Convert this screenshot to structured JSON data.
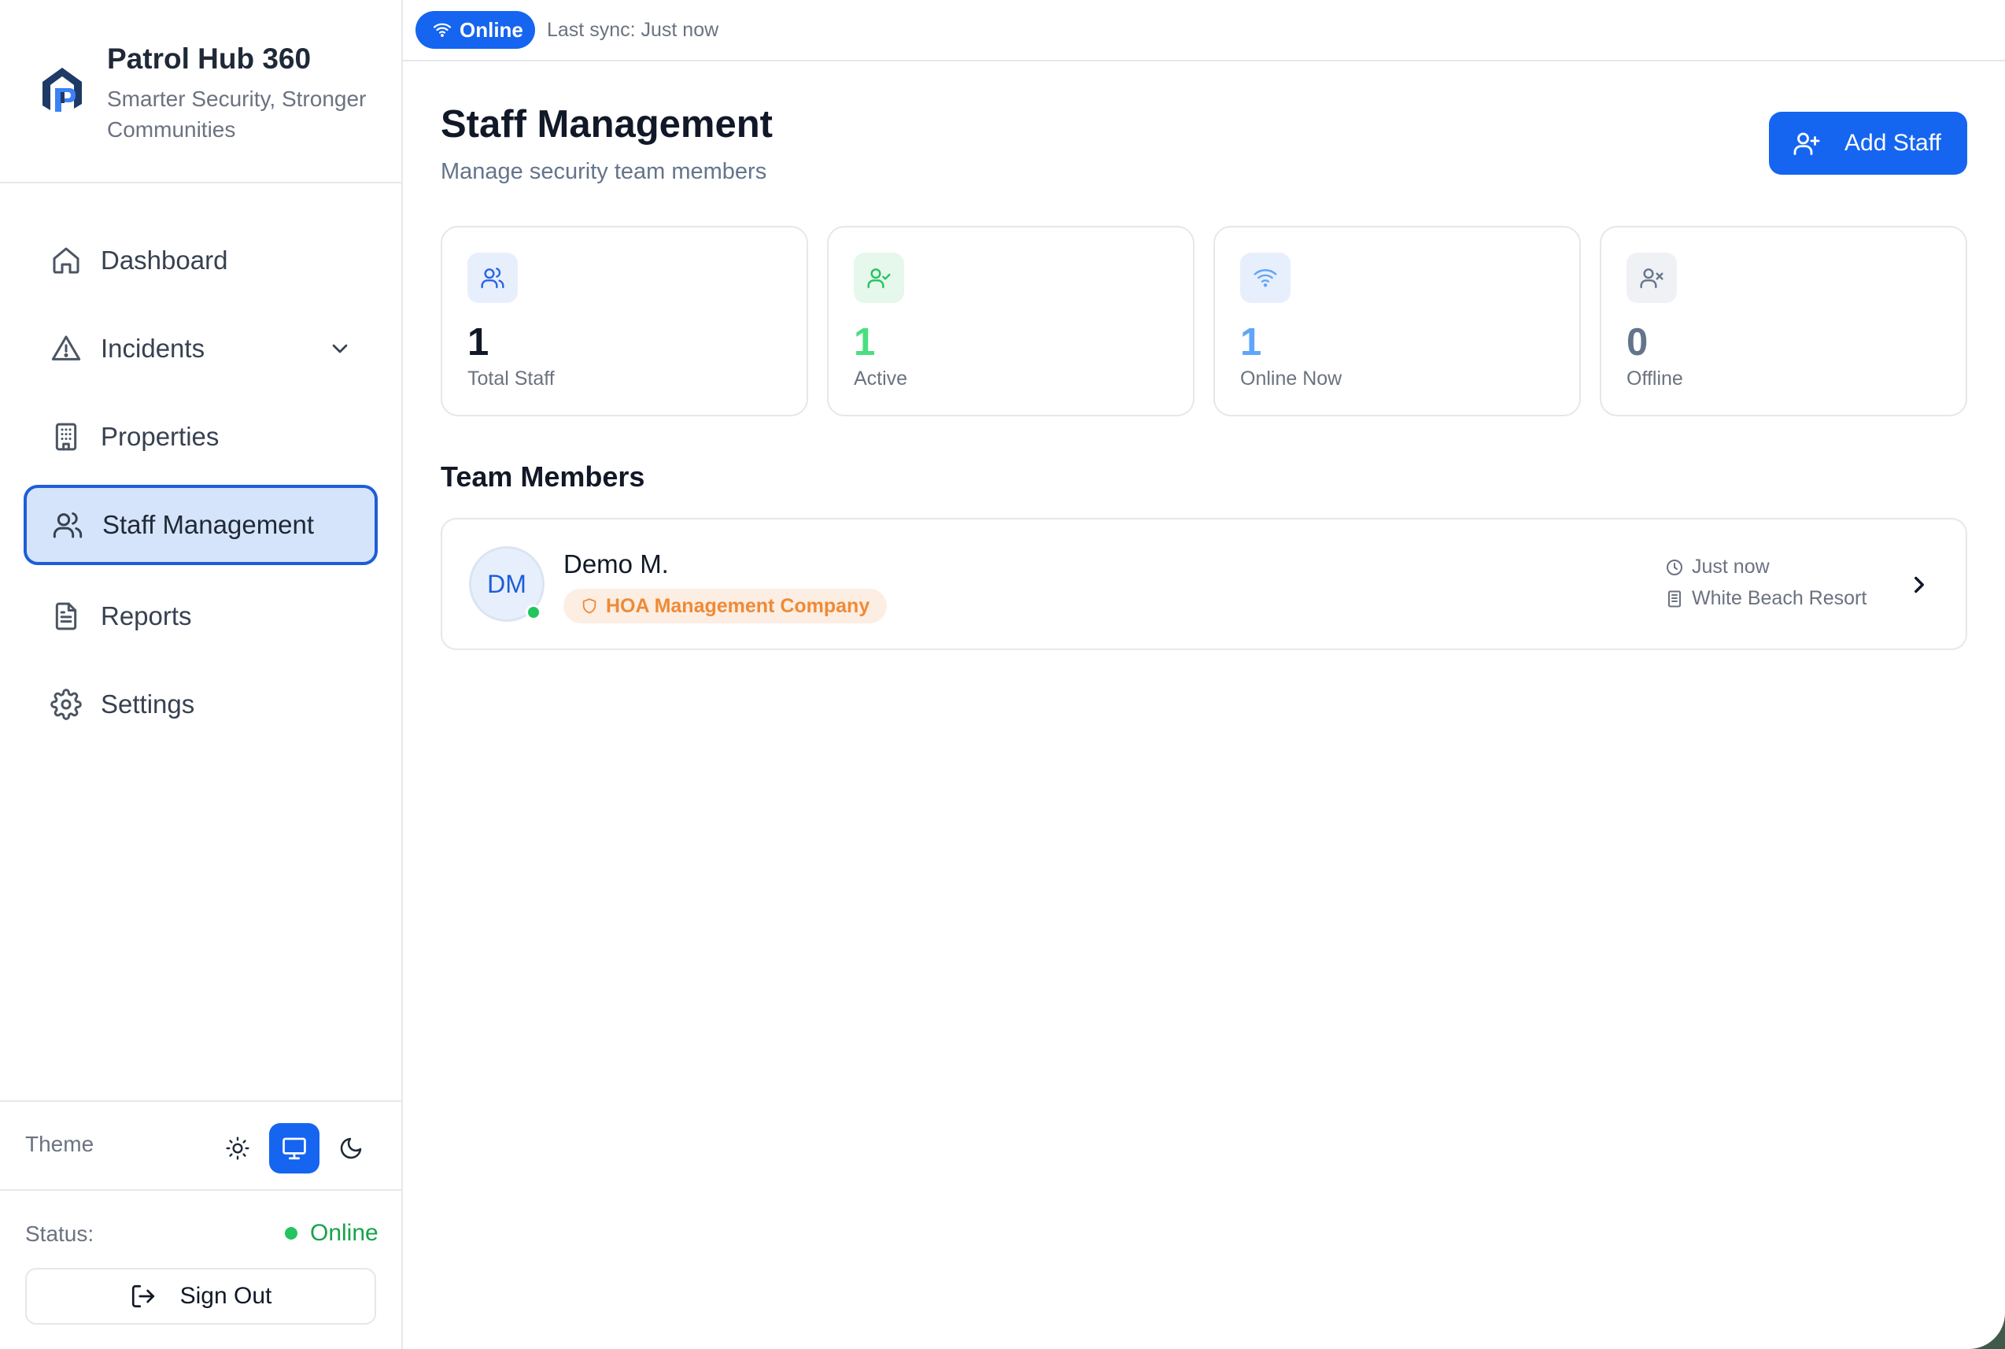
{
  "brand": {
    "title": "Patrol Hub 360",
    "subtitle": "Smarter Security, Stronger Communities",
    "logo_icon": "shield-p-logo"
  },
  "sidebar": {
    "items": [
      {
        "label": "Dashboard",
        "icon": "home-icon",
        "active": false
      },
      {
        "label": "Incidents",
        "icon": "alert-triangle-icon",
        "active": false,
        "expandable": true
      },
      {
        "label": "Properties",
        "icon": "building-icon",
        "active": false
      },
      {
        "label": "Staff Management",
        "icon": "users-icon",
        "active": true
      },
      {
        "label": "Reports",
        "icon": "file-text-icon",
        "active": false
      },
      {
        "label": "Settings",
        "icon": "gear-icon",
        "active": false
      }
    ],
    "theme": {
      "label": "Theme",
      "options": [
        "light",
        "system",
        "dark"
      ],
      "selected": "system"
    },
    "status": {
      "label": "Status:",
      "value": "Online"
    },
    "sign_out_label": "Sign Out"
  },
  "topbar": {
    "connection_label": "Online",
    "sync_text": "Last sync: Just now"
  },
  "page": {
    "title": "Staff Management",
    "subtitle": "Manage security team members",
    "add_button_label": "Add Staff"
  },
  "stats": [
    {
      "value": "1",
      "label": "Total Staff",
      "icon": "users-icon",
      "color": "#111827"
    },
    {
      "value": "1",
      "label": "Active",
      "icon": "user-check-icon",
      "color": "#4ade80"
    },
    {
      "value": "1",
      "label": "Online Now",
      "icon": "wifi-icon",
      "color": "#60a5fa"
    },
    {
      "value": "0",
      "label": "Offline",
      "icon": "user-x-icon",
      "color": "#64748b"
    }
  ],
  "team": {
    "title": "Team Members",
    "members": [
      {
        "initials": "DM",
        "name": "Demo M.",
        "role": "HOA Management Company",
        "last_seen": "Just now",
        "property": "White Beach Resort",
        "online": true
      }
    ]
  },
  "colors": {
    "primary": "#1565f0",
    "active_nav_bg": "#d6e4fb",
    "online_green": "#16a34a",
    "role_orange": "#ef8a36"
  }
}
